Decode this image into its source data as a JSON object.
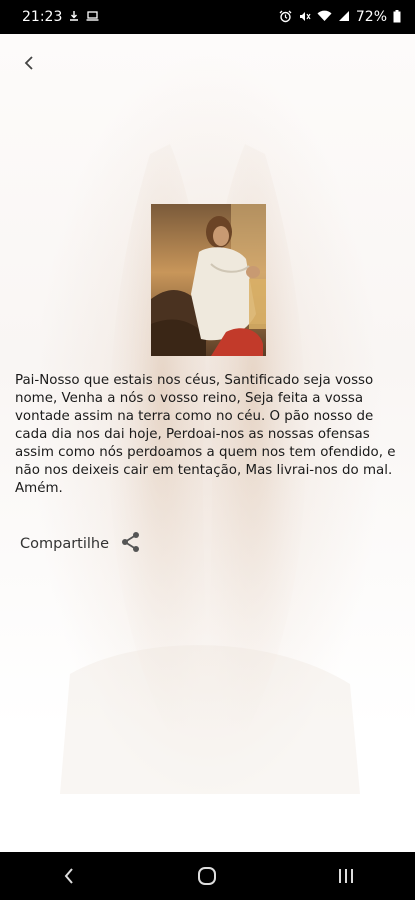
{
  "status": {
    "time": "21:23",
    "battery": "72%",
    "left_icons": [
      "usb-download-icon",
      "laptop-icon"
    ],
    "right_icons": [
      "alarm-icon",
      "mute-icon",
      "wifi-icon",
      "signal-icon",
      "battery-icon"
    ]
  },
  "prayer": {
    "text": "Pai-Nosso que estais nos céus, Santificado seja vosso nome, Venha a nós o vosso reino, Seja feita a vossa vontade assim na terra como no céu. O pão nosso de cada dia nos dai hoje, Perdoai-nos as nossas ofensas assim como nós perdoamos a quem nos tem ofendido, e não nos deixeis cair em tentação, Mas livrai-nos do mal. Amém."
  },
  "share": {
    "label": "Compartilhe",
    "icon": "share-icon"
  },
  "colors": {
    "status_bar": "#000000",
    "nav_bar": "#000000",
    "text": "#1a1a1a"
  }
}
